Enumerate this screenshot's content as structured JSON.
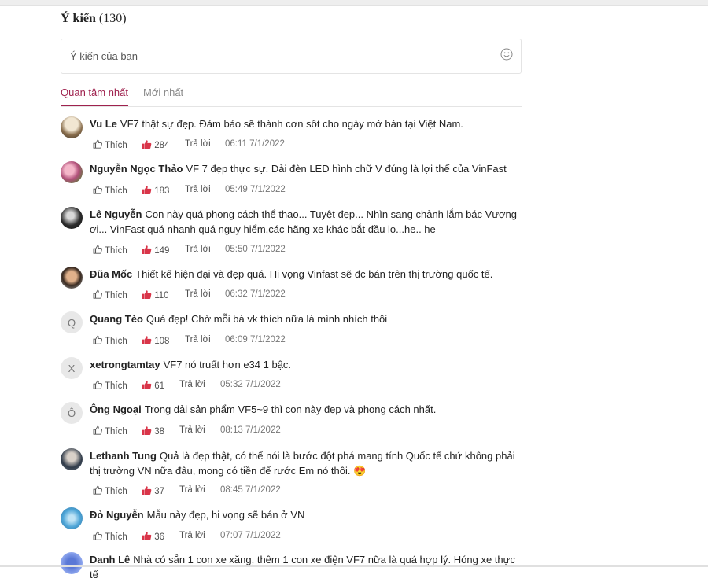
{
  "section": {
    "title": "Ý kiến",
    "count": "(130)"
  },
  "input": {
    "placeholder": "Ý kiến của bạn",
    "icon": "smiley-icon"
  },
  "tabs": [
    {
      "label": "Quan tâm nhất",
      "active": true
    },
    {
      "label": "Mới nhất",
      "active": false
    }
  ],
  "labels": {
    "like": "Thích",
    "reply": "Trả lời"
  },
  "colors": {
    "accent": "#9f224e",
    "like_icon": "#d0021b"
  },
  "comments": [
    {
      "name": "Vu Le",
      "text": "VF7 thật sự đẹp. Đảm bảo sẽ thành cơn sốt cho ngày mở bán tại Việt Nam.",
      "likes": "284",
      "time": "06:11 7/1/2022",
      "avatar": "photo"
    },
    {
      "name": "Nguyễn Ngọc Thảo",
      "text": "VF 7 đẹp thực sự. Dải đèn LED hình chữ V đúng là lợi thế của VinFast",
      "likes": "183",
      "time": "05:49 7/1/2022",
      "avatar": "photo"
    },
    {
      "name": "Lê Nguyễn",
      "text": "Con này quá phong cách thể thao... Tuyệt đẹp... Nhìn sang chảnh lắm bác Vượng ơi... VinFast quá nhanh quá nguy hiểm,các hãng xe khác bắt đầu lo...he.. he",
      "likes": "149",
      "time": "05:50 7/1/2022",
      "avatar": "photo"
    },
    {
      "name": "Đũa Mốc",
      "text": "Thiết kế hiện đại và đẹp quá. Hi vọng Vinfast sẽ đc bán trên thị trường quốc tế.",
      "likes": "110",
      "time": "06:32 7/1/2022",
      "avatar": "photo"
    },
    {
      "name": "Quang Tèo",
      "text": "Quá đẹp! Chờ mỗi bà vk thích nữa là mình nhích thôi",
      "likes": "108",
      "time": "06:09 7/1/2022",
      "avatar": "Q"
    },
    {
      "name": "xetrongtamtay",
      "text": "VF7 nó truất hơn e34 1 bậc.",
      "likes": "61",
      "time": "05:32 7/1/2022",
      "avatar": "X"
    },
    {
      "name": "Ông Ngoại",
      "text": "Trong dải sản phẩm VF5~9 thì con này đẹp và phong cách nhất.",
      "likes": "38",
      "time": "08:13 7/1/2022",
      "avatar": "Ô"
    },
    {
      "name": "Lethanh Tung",
      "text": "Quả là đẹp thật, có thể nói là bước đột phá mang tính Quốc tế chứ không phải thị trường VN nữa đâu, mong có tiền để rước Em nó thôi. 😍",
      "likes": "37",
      "time": "08:45 7/1/2022",
      "avatar": "photo"
    },
    {
      "name": "Đỏ Nguyễn",
      "text": "Mẫu này đẹp, hi vọng sẽ bán ở VN",
      "likes": "36",
      "time": "07:07 7/1/2022",
      "avatar": "photo"
    },
    {
      "name": "Danh Lê",
      "text": "Nhà có sẵn 1 con xe xăng, thêm 1 con xe điện VF7 nữa là quá hợp lý. Hóng xe thực tế",
      "avatar": "photo"
    }
  ]
}
